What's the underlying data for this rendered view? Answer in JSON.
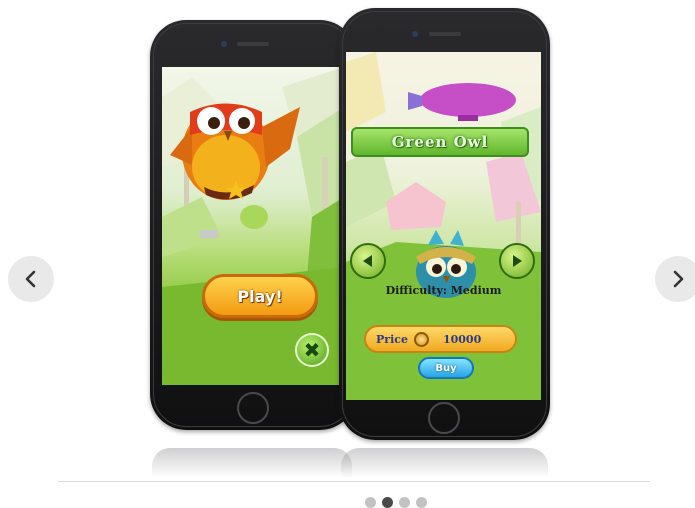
{
  "carousel": {
    "prev_icon": "chevron-left-icon",
    "next_icon": "chevron-right-icon",
    "slide_count": 4,
    "active_slide": 2
  },
  "screen1": {
    "play_label": "Play!",
    "close_icon": "close-icon"
  },
  "screen2": {
    "title": "Green Owl",
    "difficulty": "Difficulty: Medium",
    "price_label": "Price",
    "price_value": "10000",
    "buy_label": "Buy",
    "prev_icon": "triangle-left-icon",
    "next_icon": "triangle-right-icon"
  },
  "colors": {
    "dot_active": "#4a4a4a",
    "dot_inactive": "#c2c2c2",
    "play_button": "#f29b12",
    "title_banner": "#5fb62c",
    "buy_button": "#27a4e6"
  }
}
